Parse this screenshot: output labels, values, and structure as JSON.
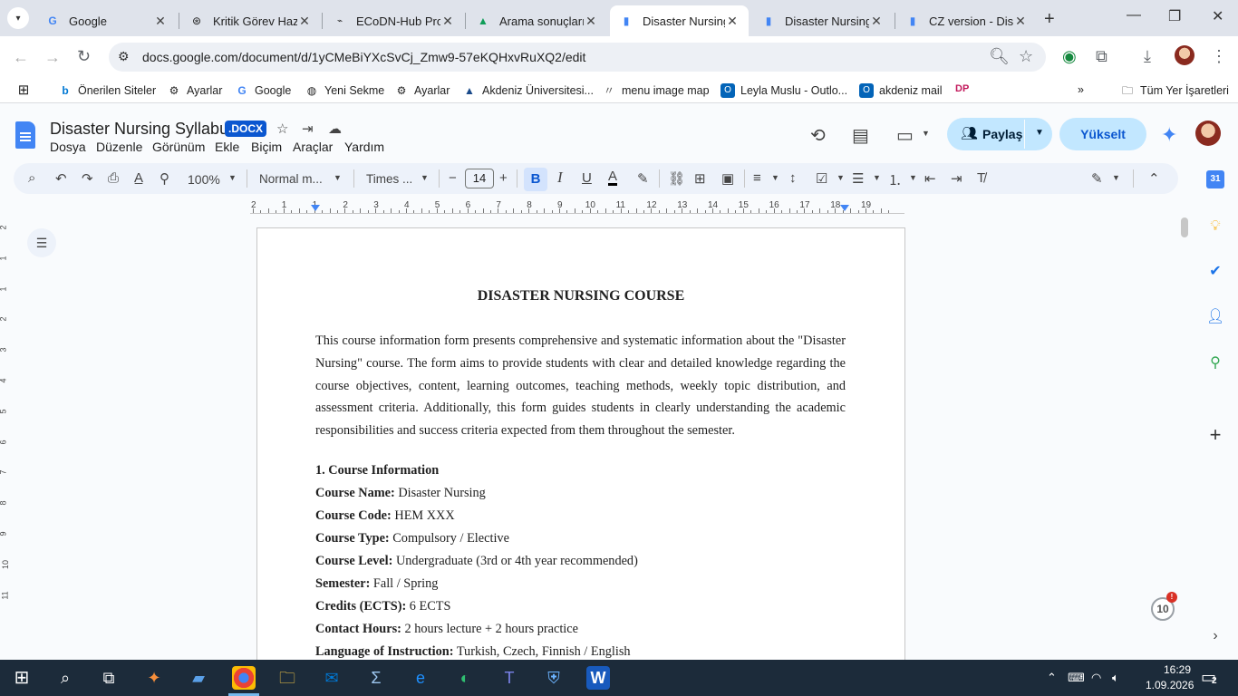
{
  "browser": {
    "tabs": [
      {
        "title": "Google",
        "icon": "google-icon"
      },
      {
        "title": "Kritik Görev Haz",
        "icon": "chatgpt-icon"
      },
      {
        "title": "ECoDN-Hub Pro",
        "icon": "ecodn-icon"
      },
      {
        "title": "Arama sonuçları",
        "icon": "drive-icon"
      },
      {
        "title": "Disaster Nursing",
        "icon": "docs-icon",
        "active": true
      },
      {
        "title": "Disaster Nursing",
        "icon": "docs-icon"
      },
      {
        "title": "CZ version - Disc",
        "icon": "docs-icon"
      }
    ],
    "url": "docs.google.com/document/d/1yCMeBiYXcSvCj_Zmw9-57eKQHxvRuXQ2/edit",
    "bookmarks": [
      "Önerilen Siteler",
      "Ayarlar",
      "Google",
      "Yeni Sekme",
      "Ayarlar",
      "Akdeniz Üniversitesi...",
      "menu image map",
      "Leyla Muslu - Outlo...",
      "akdeniz mail",
      "DP"
    ],
    "all_bookmarks": "Tüm Yer İşaretleri"
  },
  "docs": {
    "title": "Disaster Nursing Syllabus",
    "badge": ".DOCX",
    "menu": [
      "Dosya",
      "Düzenle",
      "Görünüm",
      "Ekle",
      "Biçim",
      "Araçlar",
      "Yardım"
    ],
    "share_label": "Paylaş",
    "upgrade_label": "Yükselt",
    "zoom": "100%",
    "style": "Normal m...",
    "font": "Times ...",
    "font_size": "14",
    "ruler_numbers": [
      "2",
      "1",
      "1",
      "2",
      "3",
      "4",
      "5",
      "6",
      "7",
      "8",
      "9",
      "10",
      "11",
      "12",
      "13",
      "14",
      "15",
      "16",
      "17",
      "18",
      "19"
    ],
    "vertical_ruler_numbers": [
      "2",
      "1",
      "1",
      "2",
      "3",
      "4",
      "5",
      "6",
      "7",
      "8",
      "9",
      "10",
      "11"
    ]
  },
  "document": {
    "heading": "DISASTER NURSING COURSE",
    "intro": "This course information form presents comprehensive and systematic information about the \"Disaster Nursing\" course. The form aims to provide students with clear and detailed knowledge regarding the course objectives, content, learning outcomes, teaching methods, weekly topic distribution, and assessment criteria. Additionally, this form guides students in clearly understanding the academic responsibilities and success criteria expected from them throughout the semester.",
    "section_title": "1. Course Information",
    "fields": [
      {
        "label": "Course Name:",
        "value": " Disaster Nursing"
      },
      {
        "label": "Course Code:",
        "value": " HEM XXX"
      },
      {
        "label": "Course Type:",
        "value": " Compulsory / Elective"
      },
      {
        "label": "Course Level:",
        "value": " Undergraduate (3rd or 4th year recommended)"
      },
      {
        "label": "Semester:",
        "value": " Fall / Spring"
      },
      {
        "label": "Credits (ECTS):",
        "value": " 6 ECTS"
      },
      {
        "label": "Contact Hours:",
        "value": " 2 hours lecture + 2 hours practice"
      },
      {
        "label": "Language of Instruction:",
        "value": " Turkish, Czech, Finnish / English"
      }
    ]
  },
  "sidebar": {
    "badge_count": "10",
    "badge_alert": "!"
  },
  "taskbar": {
    "time": "16:29",
    "date": "1.09.2026",
    "notifications": "2"
  },
  "colors": {
    "accent": "#0b57d0",
    "share_bg": "#c2e7ff",
    "taskbar": "#1c2b3a"
  }
}
